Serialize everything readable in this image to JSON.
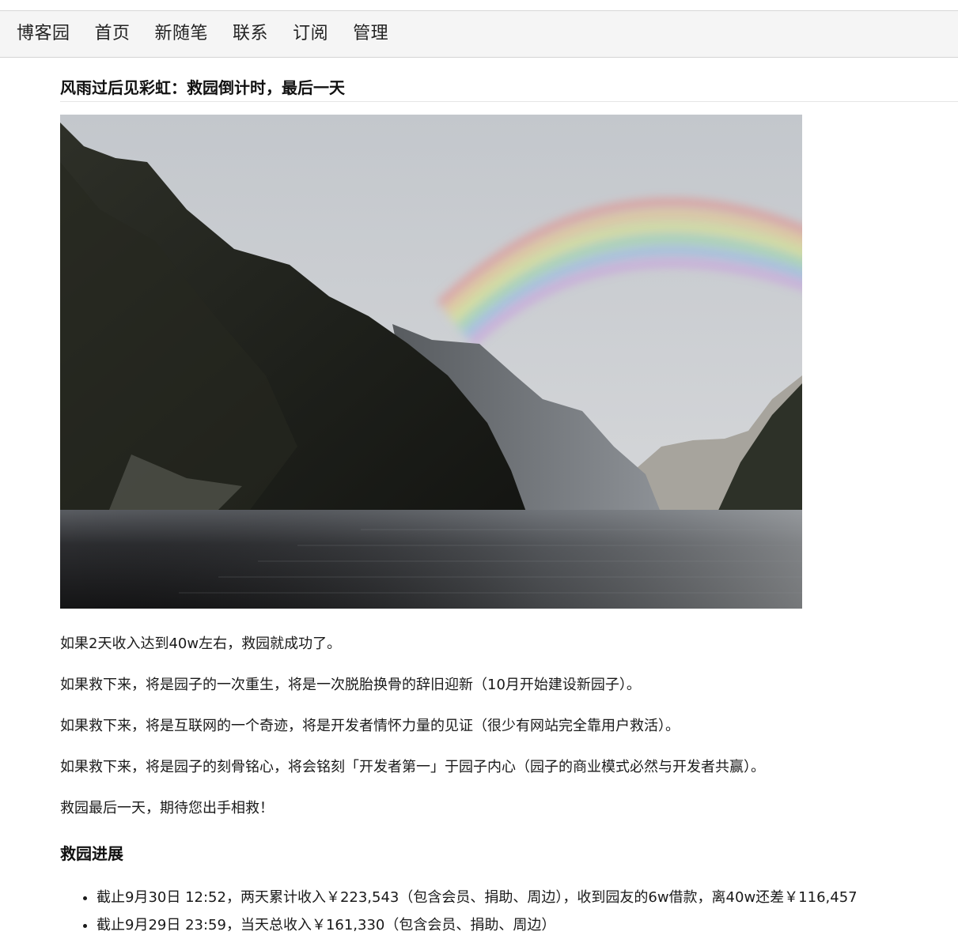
{
  "nav": {
    "items": [
      "博客园",
      "首页",
      "新随笔",
      "联系",
      "订阅",
      "管理"
    ]
  },
  "post": {
    "title": "风雨过后见彩虹：救园倒计时，最后一天",
    "hero_image": "fjord-rainbow-landscape",
    "paragraphs": [
      "如果2天收入达到40w左右，救园就成功了。",
      "如果救下来，将是园子的一次重生，将是一次脱胎换骨的辞旧迎新（10月开始建设新园子）。",
      "如果救下来，将是互联网的一个奇迹，将是开发者情怀力量的见证（很少有网站完全靠用户救活）。",
      "如果救下来，将是园子的刻骨铭心，将会铭刻「开发者第一」于园子内心（园子的商业模式必然与开发者共赢）。",
      "救园最后一天，期待您出手相救！"
    ],
    "section_title": "救园进展",
    "progress": [
      "截止9月30日 12:52，两天累计收入￥223,543（包含会员、捐助、周边），收到园友的6w借款，离40w还差￥116,457",
      "截止9月29日 23:59，当天总收入￥161,330（包含会员、捐助、周边）"
    ]
  },
  "colors": {
    "nav_bg": "#f5f5f5",
    "text": "#1a1a1a"
  }
}
